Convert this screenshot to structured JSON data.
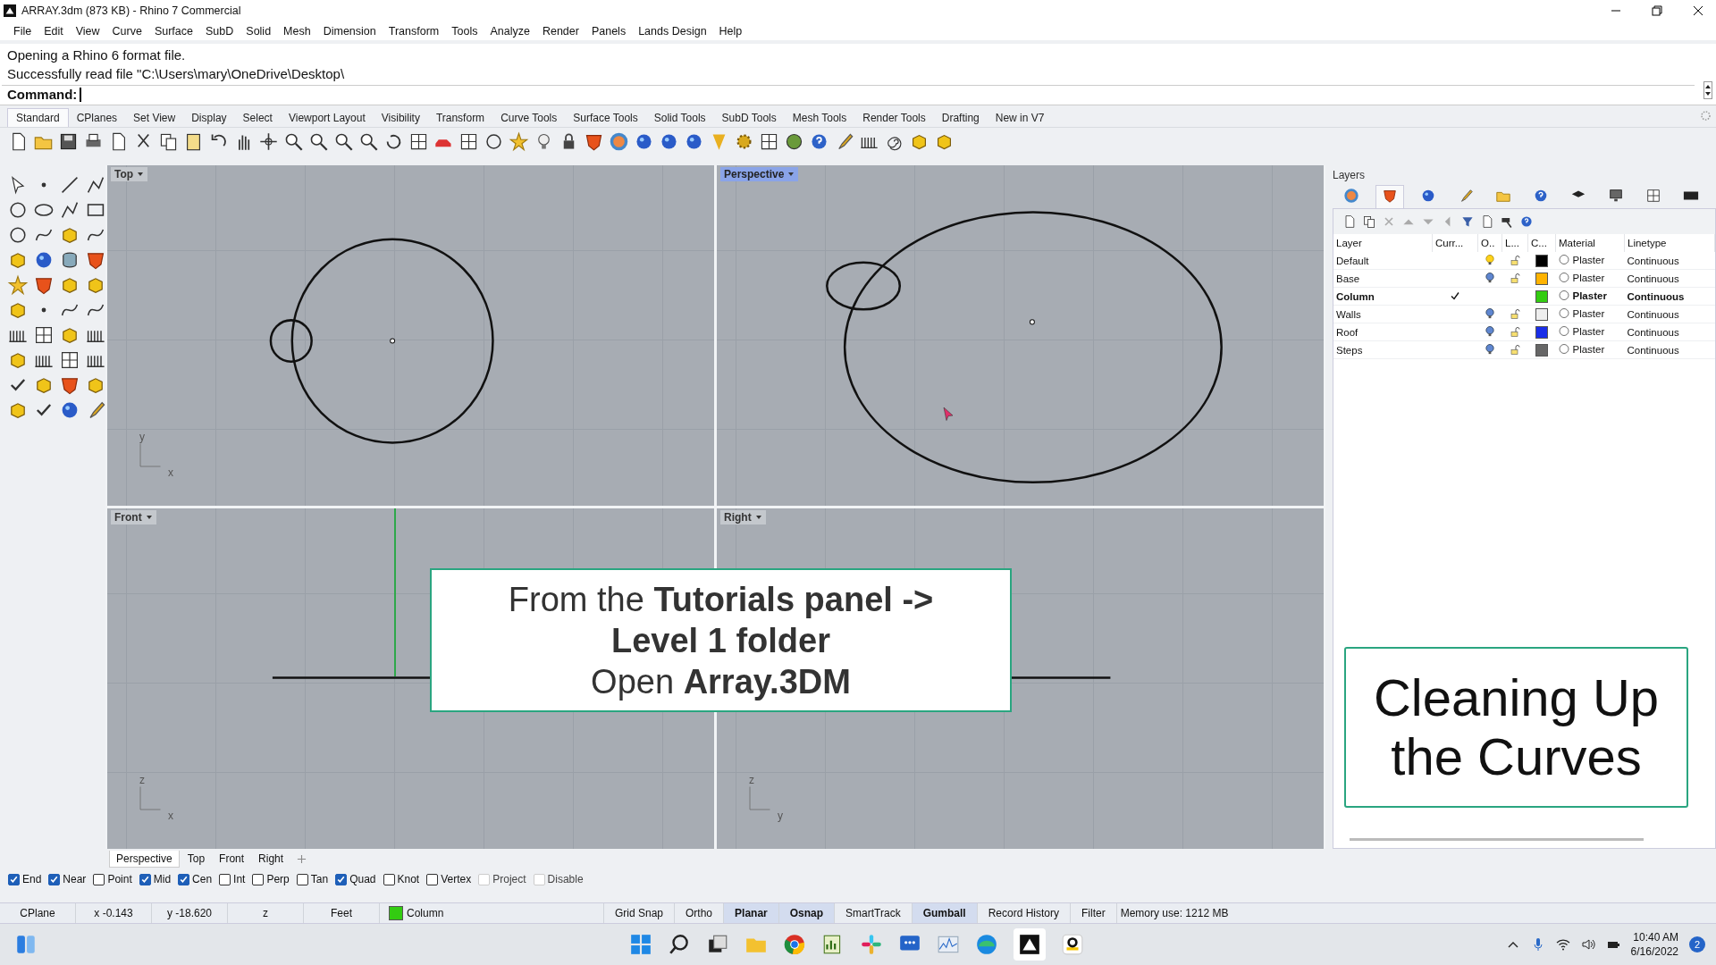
{
  "window": {
    "title": "ARRAY.3dm (873 KB) - Rhino 7 Commercial"
  },
  "menu": [
    "File",
    "Edit",
    "View",
    "Curve",
    "Surface",
    "SubD",
    "Solid",
    "Mesh",
    "Dimension",
    "Transform",
    "Tools",
    "Analyze",
    "Render",
    "Panels",
    "Lands Design",
    "Help"
  ],
  "command_history": [
    "Opening a Rhino 6 format file.",
    "Successfully read file \"C:\\Users\\mary\\OneDrive\\Desktop\\"
  ],
  "command_prompt": {
    "label": "Command:"
  },
  "toolbar_tabs": [
    {
      "label": "Standard",
      "selected": true
    },
    {
      "label": "CPlanes",
      "selected": false
    },
    {
      "label": "Set View",
      "selected": false
    },
    {
      "label": "Display",
      "selected": false
    },
    {
      "label": "Select",
      "selected": false
    },
    {
      "label": "Viewport Layout",
      "selected": false
    },
    {
      "label": "Visibility",
      "selected": false
    },
    {
      "label": "Transform",
      "selected": false
    },
    {
      "label": "Curve Tools",
      "selected": false
    },
    {
      "label": "Surface Tools",
      "selected": false
    },
    {
      "label": "Solid Tools",
      "selected": false
    },
    {
      "label": "SubD Tools",
      "selected": false
    },
    {
      "label": "Mesh Tools",
      "selected": false
    },
    {
      "label": "Render Tools",
      "selected": false
    },
    {
      "label": "Drafting",
      "selected": false
    },
    {
      "label": "New in V7",
      "selected": false
    }
  ],
  "viewports": [
    {
      "title": "Top",
      "kind": "top",
      "selected": false,
      "axis_labels": [
        "y",
        "x"
      ]
    },
    {
      "title": "Perspective",
      "kind": "perspective",
      "selected": true
    },
    {
      "title": "Front",
      "kind": "front",
      "selected": false,
      "axis_labels": [
        "z",
        "x"
      ]
    },
    {
      "title": "Right",
      "kind": "right",
      "selected": false,
      "axis_labels": [
        "z",
        "y"
      ]
    }
  ],
  "callout": {
    "lines": [
      "From the **Tutorials panel ->**",
      "**Level 1 folder**",
      "Open **Array.3DM**"
    ]
  },
  "viewport_tabs": [
    {
      "label": "Perspective",
      "selected": true
    },
    {
      "label": "Top",
      "selected": false
    },
    {
      "label": "Front",
      "selected": false
    },
    {
      "label": "Right",
      "selected": false
    }
  ],
  "osnaps": [
    {
      "label": "End",
      "checked": true,
      "disabled": false
    },
    {
      "label": "Near",
      "checked": true,
      "disabled": false
    },
    {
      "label": "Point",
      "checked": false,
      "disabled": false
    },
    {
      "label": "Mid",
      "checked": true,
      "disabled": false
    },
    {
      "label": "Cen",
      "checked": true,
      "disabled": false
    },
    {
      "label": "Int",
      "checked": false,
      "disabled": false
    },
    {
      "label": "Perp",
      "checked": false,
      "disabled": false
    },
    {
      "label": "Tan",
      "checked": false,
      "disabled": false
    },
    {
      "label": "Quad",
      "checked": true,
      "disabled": false
    },
    {
      "label": "Knot",
      "checked": false,
      "disabled": false
    },
    {
      "label": "Vertex",
      "checked": false,
      "disabled": false
    },
    {
      "label": "Project",
      "checked": false,
      "disabled": true
    },
    {
      "label": "Disable",
      "checked": false,
      "disabled": true
    }
  ],
  "status_bar": [
    {
      "kind": "text",
      "text": "CPlane"
    },
    {
      "kind": "text",
      "text": "x -0.143"
    },
    {
      "kind": "text",
      "text": "y -18.620"
    },
    {
      "kind": "text",
      "text": "z"
    },
    {
      "kind": "text",
      "text": "Feet"
    },
    {
      "kind": "layer",
      "text": "Column",
      "color": "#33cc11"
    },
    {
      "kind": "toggle",
      "text": "Grid Snap",
      "on": false
    },
    {
      "kind": "toggle",
      "text": "Ortho",
      "on": false
    },
    {
      "kind": "toggle",
      "text": "Planar",
      "on": true
    },
    {
      "kind": "toggle",
      "text": "Osnap",
      "on": true
    },
    {
      "kind": "toggle",
      "text": "SmartTrack",
      "on": false
    },
    {
      "kind": "toggle",
      "text": "Gumball",
      "on": true
    },
    {
      "kind": "toggle",
      "text": "Record History",
      "on": false
    },
    {
      "kind": "toggle",
      "text": "Filter",
      "on": false
    },
    {
      "kind": "info",
      "text": "Memory use: 1212 MB"
    }
  ],
  "layers_panel": {
    "title": "Layers",
    "columns": [
      "Layer",
      "Curr...",
      "O..",
      "L...",
      "C...",
      "Material",
      "Linetype"
    ],
    "rows": [
      {
        "name": "Default",
        "current": false,
        "lit": true,
        "color": "#000000",
        "material": "Plaster",
        "linetype": "Continuous"
      },
      {
        "name": "Base",
        "current": false,
        "lit": false,
        "color": "#ffb300",
        "material": "Plaster",
        "linetype": "Continuous"
      },
      {
        "name": "Column",
        "current": true,
        "color": "#33cc11",
        "material": "Plaster",
        "linetype": "Continuous"
      },
      {
        "name": "Walls",
        "current": false,
        "lit": false,
        "color": "#eeeeee",
        "material": "Plaster",
        "linetype": "Continuous"
      },
      {
        "name": "Roof",
        "current": false,
        "lit": false,
        "color": "#1a2ee8",
        "material": "Plaster",
        "linetype": "Continuous"
      },
      {
        "name": "Steps",
        "current": false,
        "lit": false,
        "color": "#666666",
        "material": "Plaster",
        "linetype": "Continuous"
      }
    ]
  },
  "title_card": {
    "text": "Cleaning Up the Curves"
  },
  "taskbar": {
    "time": "10:40 AM",
    "date": "6/16/2022",
    "notification_count": "2"
  }
}
